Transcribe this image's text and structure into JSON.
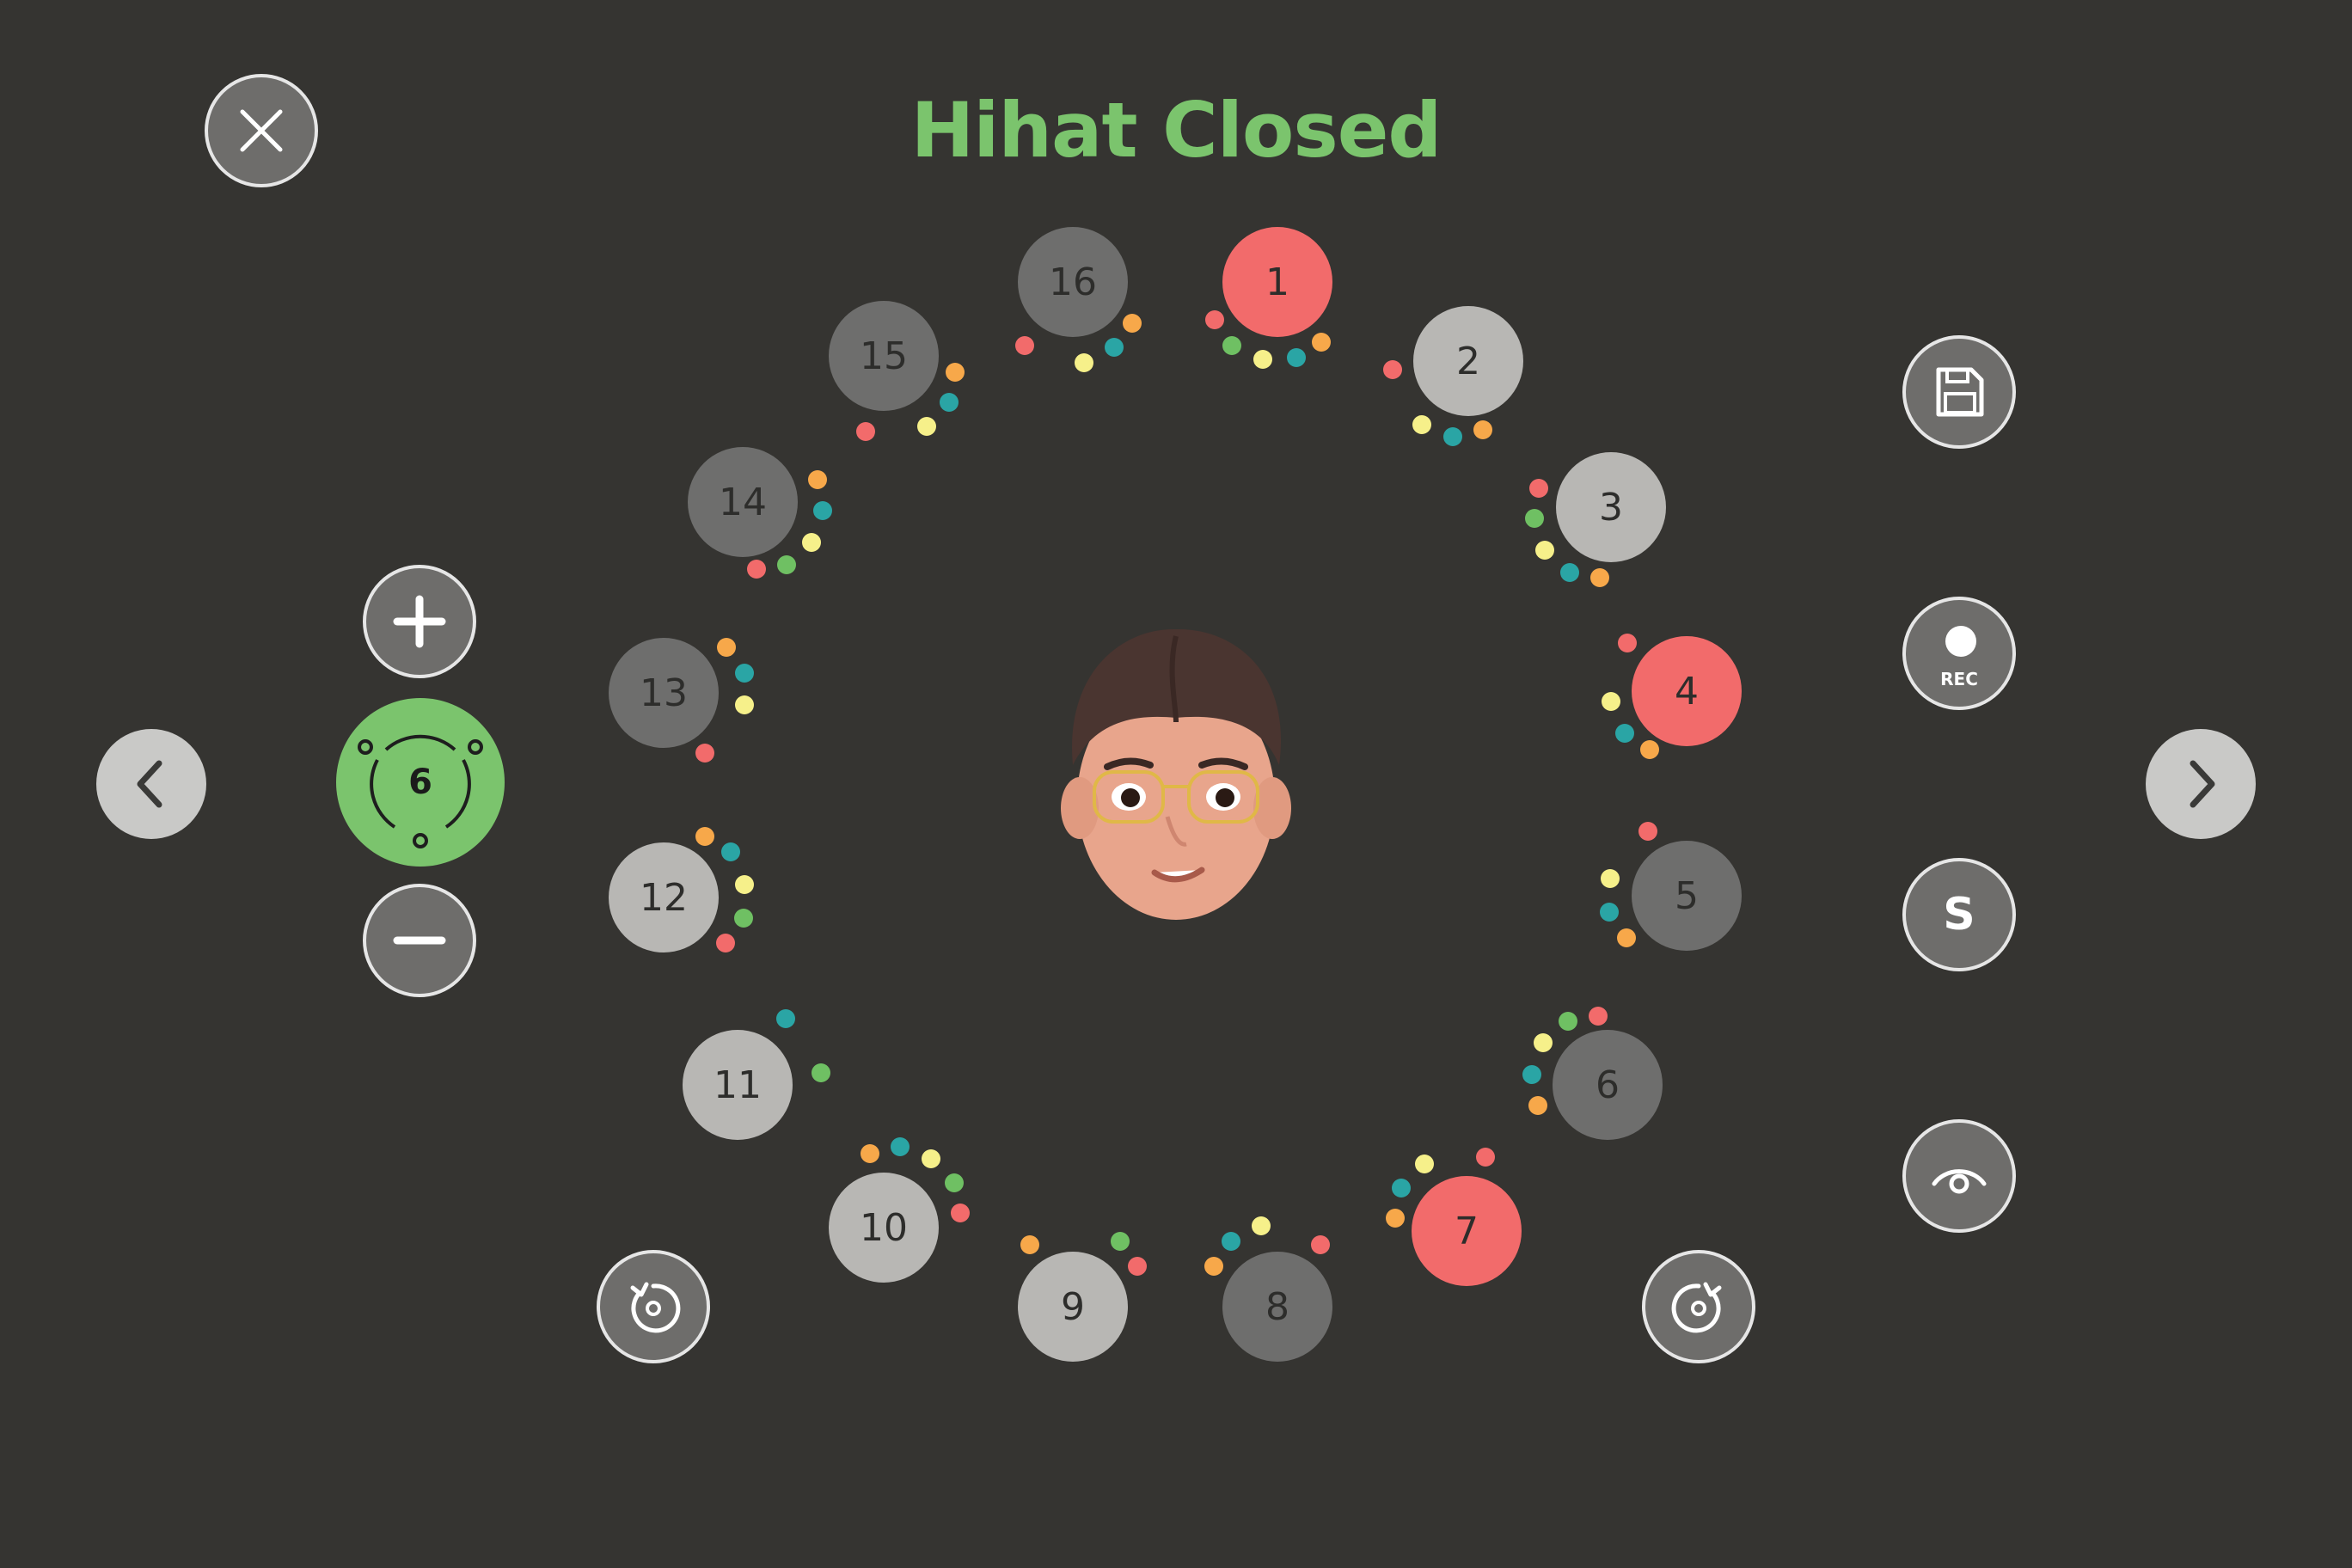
{
  "title": "Hihat Closed",
  "colors": {
    "background": "#353431",
    "title": "#7bc46d",
    "active_step": "#f26b6b",
    "knob": "#7bc46d"
  },
  "left_controls": {
    "close_icon": "close-icon",
    "plus_icon": "plus-icon",
    "minus_icon": "minus-icon",
    "value": "6",
    "prev_icon": "chevron-left-icon"
  },
  "right_controls": {
    "save_icon": "save-icon",
    "rec_label": "REC",
    "solo_label": "S",
    "view_icon": "eye-icon",
    "next_icon": "chevron-right-icon"
  },
  "bottom_controls": {
    "rotate_left_icon": "rotate-counterclockwise-icon",
    "rotate_right_icon": "rotate-clockwise-icon"
  },
  "center": {
    "avatar_icon": "memoji-avatar"
  },
  "steps": [
    {
      "label": "1",
      "state": "active"
    },
    {
      "label": "2",
      "state": "light"
    },
    {
      "label": "3",
      "state": "light"
    },
    {
      "label": "4",
      "state": "active"
    },
    {
      "label": "5",
      "state": "dark"
    },
    {
      "label": "6",
      "state": "dark"
    },
    {
      "label": "7",
      "state": "active"
    },
    {
      "label": "8",
      "state": "dark"
    },
    {
      "label": "9",
      "state": "light"
    },
    {
      "label": "10",
      "state": "light"
    },
    {
      "label": "11",
      "state": "light"
    },
    {
      "label": "12",
      "state": "light"
    },
    {
      "label": "13",
      "state": "dark"
    },
    {
      "label": "14",
      "state": "dark"
    },
    {
      "label": "15",
      "state": "dark"
    },
    {
      "label": "16",
      "state": "dark"
    }
  ]
}
